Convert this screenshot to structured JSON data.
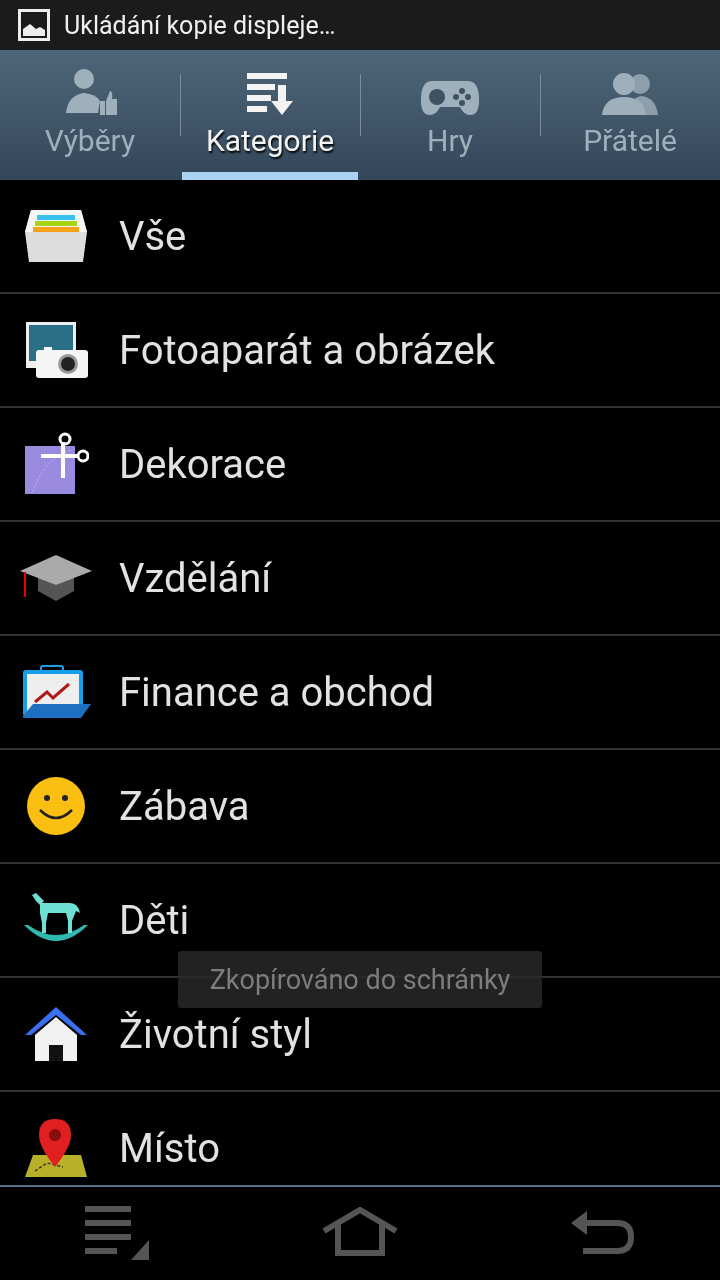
{
  "status_bar": {
    "notification": "Ukládání kopie displeje…"
  },
  "tabs": [
    {
      "label": "Výběry",
      "selected": false
    },
    {
      "label": "Kategorie",
      "selected": true
    },
    {
      "label": "Hry",
      "selected": false
    },
    {
      "label": "Přátelé",
      "selected": false
    }
  ],
  "categories": [
    {
      "label": "Vše"
    },
    {
      "label": "Fotoaparát a obrázek"
    },
    {
      "label": "Dekorace"
    },
    {
      "label": "Vzdělání"
    },
    {
      "label": "Finance a obchod"
    },
    {
      "label": "Zábava"
    },
    {
      "label": "Děti"
    },
    {
      "label": "Životní styl"
    },
    {
      "label": "Místo"
    }
  ],
  "toast": {
    "text": "Zkopírováno do schránky"
  }
}
